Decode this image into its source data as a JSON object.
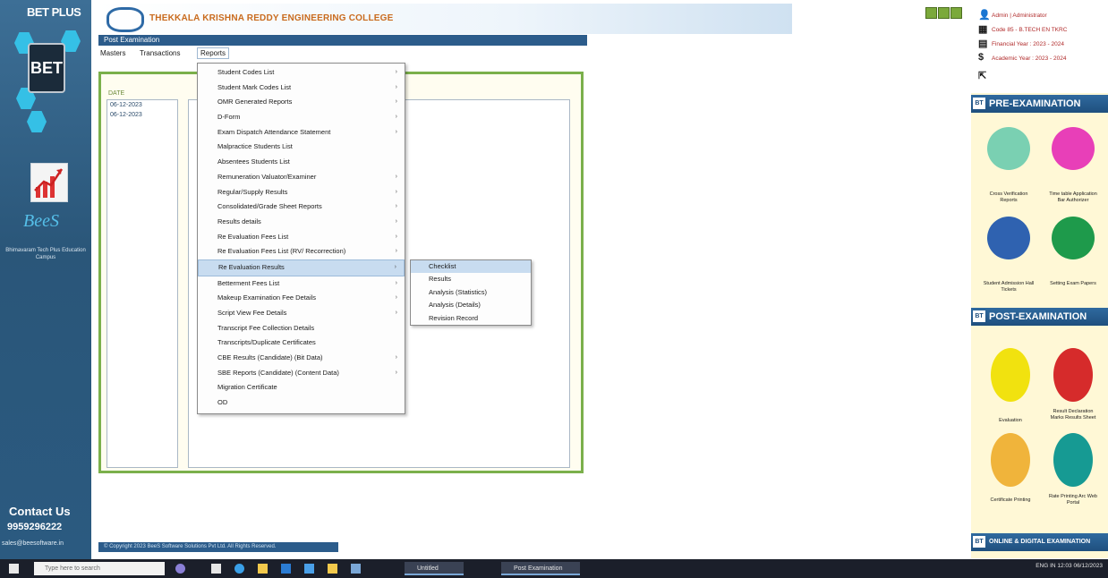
{
  "sidebar": {
    "brand": "BET PLUS",
    "badge": "BET",
    "product": "BeeS",
    "tagline": "Bhimavaram Tech Plus Education Campus",
    "contact_label": "Contact Us",
    "phone": "9959296222",
    "email": "sales@beesoftware.in"
  },
  "header": {
    "college_name": "THEKKALA KRISHNA REDDY ENGINEERING COLLEGE",
    "window_title": "Post Examination"
  },
  "menu": [
    "Masters",
    "Transactions",
    "Reports"
  ],
  "panel": {
    "list_label": "DATE",
    "list_items": [
      "06-12-2023",
      "06-12-2023"
    ]
  },
  "dropdown": {
    "items": [
      {
        "label": "Student Codes List",
        "sub": true
      },
      {
        "label": "Student Mark Codes List",
        "sub": true
      },
      {
        "label": "OMR Generated Reports",
        "sub": true
      },
      {
        "label": "D-Form",
        "sub": true
      },
      {
        "label": "Exam Dispatch Attendance Statement",
        "sub": true
      },
      {
        "label": "Malpractice Students List",
        "sub": false
      },
      {
        "label": "Absentees Students List",
        "sub": false
      },
      {
        "label": "Remuneration Valuator/Examiner",
        "sub": true
      },
      {
        "label": "Regular/Supply Results",
        "sub": true
      },
      {
        "label": "Consolidated/Grade Sheet Reports",
        "sub": true
      },
      {
        "label": "Results details",
        "sub": true
      },
      {
        "label": "Re Evaluation Fees List",
        "sub": true
      },
      {
        "label": "Re Evaluation Fees List (RV/ Recorrection)",
        "sub": true
      },
      {
        "label": "Re Evaluation Results",
        "sub": true,
        "highlighted": true
      },
      {
        "label": "Betterment Fees List",
        "sub": true
      },
      {
        "label": "Makeup Examination Fee Details",
        "sub": true
      },
      {
        "label": "Script View Fee Details",
        "sub": true
      },
      {
        "label": "Transcript Fee Collection Details",
        "sub": false
      },
      {
        "label": "Transcripts/Duplicate Certificates",
        "sub": false
      },
      {
        "label": "CBE Results (Candidate) (Bit Data)",
        "sub": true
      },
      {
        "label": "SBE Reports (Candidate) (Content Data)",
        "sub": true
      },
      {
        "label": "Migration Certificate",
        "sub": false
      },
      {
        "label": "OD",
        "sub": false
      }
    ]
  },
  "submenu": {
    "items": [
      {
        "label": "Checklist",
        "highlighted": true
      },
      {
        "label": "Results"
      },
      {
        "label": "Analysis (Statistics)"
      },
      {
        "label": "Analysis (Details)"
      },
      {
        "label": "Revision Record"
      }
    ]
  },
  "footer": {
    "text": "© Copyright 2023 BeeS Software Solutions Pvt Ltd. All Rights Reserved."
  },
  "user": {
    "name": "Admin | Administrator",
    "college": "Code 85 - B.TECH EN TKRC",
    "financial_year": "Financial Year : 2023 - 2024",
    "academic_year": "Academic Year : 2023 - 2024"
  },
  "right_sections": {
    "pre": "PRE-EXAMINATION",
    "post": "POST-EXAMINATION",
    "online": "ONLINE & DIGITAL EXAMINATION"
  },
  "tiles": {
    "pre": [
      "Cross Verification Reports",
      "Time table Application Bar Authorizer",
      "Student Admission Hall Tickets",
      "Setting Exam Papers"
    ],
    "post": [
      "Evaluation",
      "Result Declaration Marks Results Sheet",
      "Certificate Printing",
      "Rate Printing Arc Web Portal"
    ]
  },
  "taskbar": {
    "search_placeholder": "Type here to search",
    "app1": "Untitled",
    "app2": "Post Examination",
    "tray": "ENG IN  12:03  06/12/2023"
  },
  "colors": {
    "accent": "#2c5c8b",
    "panel_border": "#7bb04b",
    "menu_highlight": "#c8dcf0"
  }
}
